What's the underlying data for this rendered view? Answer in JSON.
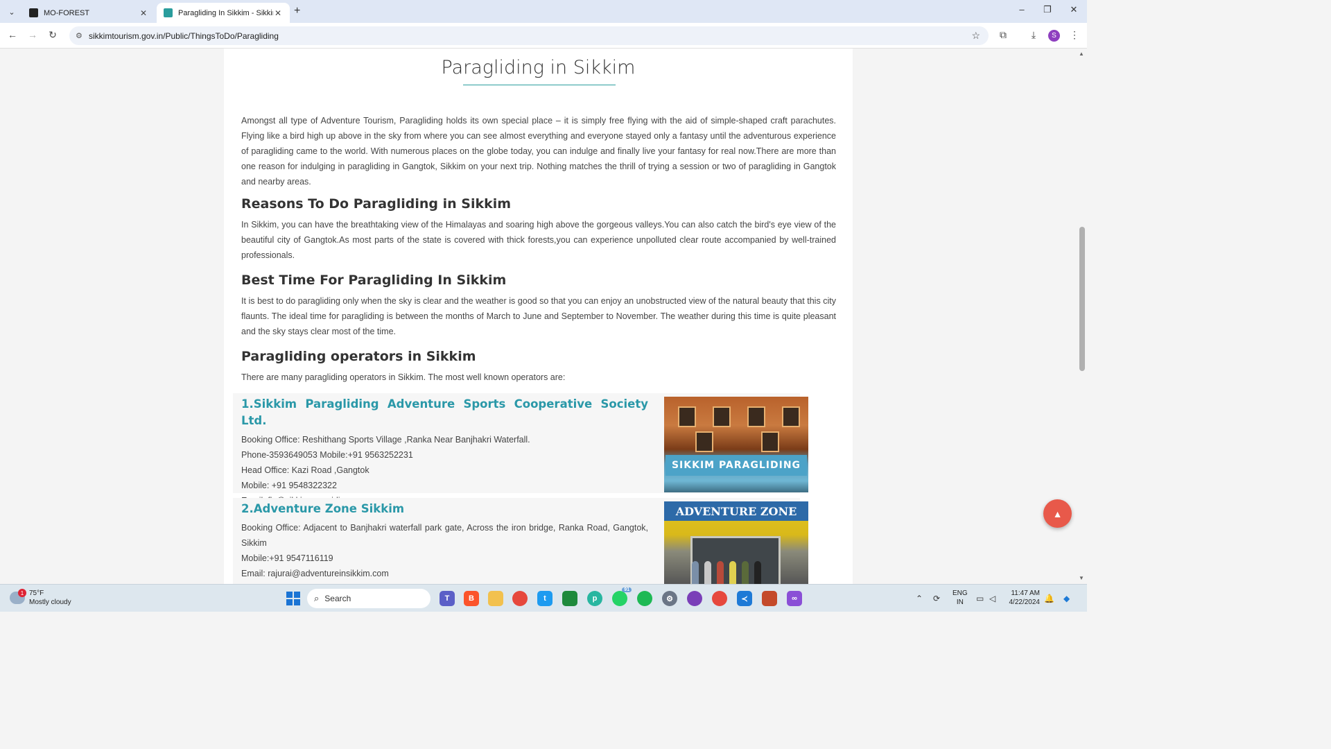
{
  "browser": {
    "tabs": [
      {
        "title": "MO-FOREST"
      },
      {
        "title": "Paragliding In Sikkim - Sikkim"
      }
    ],
    "url": "sikkimtourism.gov.in/Public/ThingsToDo/Paragliding",
    "profile_initial": "S"
  },
  "page": {
    "title": "Paragliding in Sikkim",
    "intro": "Amongst all type of Adventure Tourism, Paragliding holds its own special place – it is simply free flying with the aid of simple-shaped craft parachutes. Flying like a bird high up above in the sky from where you can see almost everything and everyone stayed only a fantasy until the adventurous experience of paragliding came to the world. With numerous places on the globe today, you can indulge and finally live your fantasy for real now.There are more than one reason for indulging in paragliding in Gangtok, Sikkim on your next trip. Nothing matches the thrill of trying a session or two of paragliding in Gangtok and nearby areas.",
    "reasons_heading": "Reasons To Do Paragliding in Sikkim",
    "reasons_text": "In Sikkim, you can have the breathtaking view of the Himalayas and soaring high above the gorgeous valleys.You can also catch the bird's eye view of the beautiful city of Gangtok.As most parts of the state is covered with thick forests,you can experience unpolluted clear route accompanied by well-trained professionals.",
    "besttime_heading": "Best Time For Paragliding In Sikkim",
    "besttime_text": "It is best to do paragliding only when the sky is clear and the weather is good so that you can enjoy an unobstructed view of the natural beauty that this city flaunts. The ideal time for paragliding is between the months of March to June and September to November. The weather during this time is quite pleasant and the sky stays clear most of the time.",
    "operators_heading": "Paragliding operators in Sikkim",
    "operators_intro": "There are many paragliding operators in Sikkim. The most well known operators are:",
    "operators": [
      {
        "name": "1.Sikkim Paragliding Adventure Sports Cooperative Society Ltd.",
        "lines": [
          "Booking Office: Reshithang Sports Village ,Ranka Near Banjhakri Waterfall.",
          "Phone-3593649053 Mobile:+91 9563252231",
          "Head Office: Kazi Road ,Gangtok",
          "Mobile: +91 9548322322",
          "Email: fly@sikkimparagiding.org"
        ],
        "image_sign": "SIKKIM PARAGLIDING"
      },
      {
        "name": "2.Adventure Zone Sikkim",
        "lines": [
          "Booking Office: Adjacent to Banjhakri waterfall park gate, Across the iron bridge, Ranka Road, Gangtok, Sikkim",
          "Mobile:+91 9547116119",
          "Email: rajurai@adventureinsikkim.com"
        ],
        "image_sign": "ADVENTURE ZONE"
      }
    ]
  },
  "taskbar": {
    "weather_temp": "75°F",
    "weather_desc": "Mostly cloudy",
    "weather_badge": "1",
    "search_placeholder": "Search",
    "whatsapp_badge": "91",
    "lang_top": "ENG",
    "lang_bottom": "IN",
    "time": "11:47 AM",
    "date": "4/22/2024"
  }
}
